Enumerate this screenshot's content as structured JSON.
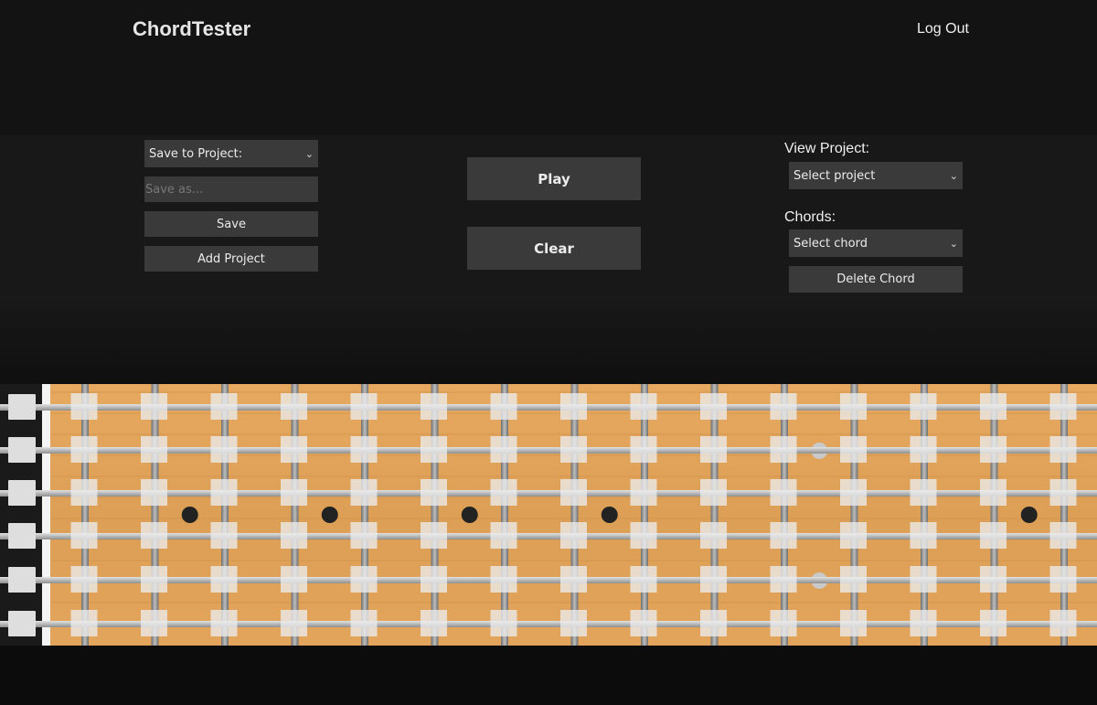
{
  "header": {
    "title": "ChordTester",
    "logout_label": "Log Out"
  },
  "save_panel": {
    "project_select_value": "Save to Project:",
    "save_as_placeholder": "Save as...",
    "save_label": "Save",
    "add_project_label": "Add Project"
  },
  "center_panel": {
    "play_label": "Play",
    "clear_label": "Clear"
  },
  "view_panel": {
    "view_project_label": "View Project:",
    "project_select_value": "Select project",
    "chords_label": "Chords:",
    "chord_select_value": "Select chord",
    "delete_chord_label": "Delete Chord"
  },
  "fretboard": {
    "strings": 6,
    "fret_columns": 15,
    "inlay_frets": [
      3,
      5,
      7,
      9,
      15
    ],
    "double_inlay_fret": 12,
    "wood_color": "#e0a35a",
    "fret_color": "#9a9a9a",
    "string_color": "#c6c6c6",
    "marker_color": "#ececec",
    "inlay_color": "#222222"
  }
}
